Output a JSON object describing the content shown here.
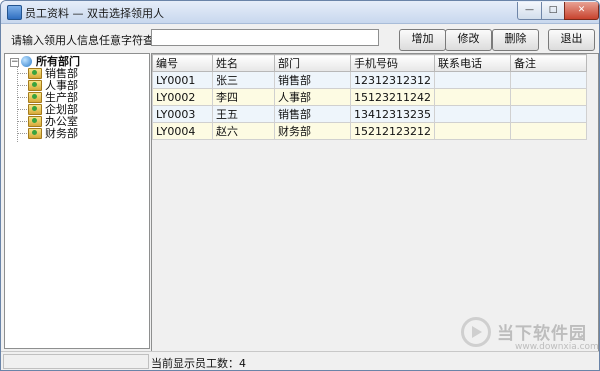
{
  "window": {
    "title": "员工资料 — 双击选择领用人",
    "minimize_glyph": "—",
    "maximize_glyph": "□",
    "close_glyph": "✕"
  },
  "toolbar": {
    "search_label": "请输入领用人信息任意字符查找",
    "search_value": "",
    "add_label": "增加",
    "edit_label": "修改",
    "delete_label": "删除",
    "exit_label": "退出"
  },
  "tree": {
    "toggle_glyph": "−",
    "root_label": "所有部门",
    "items": [
      {
        "label": "销售部"
      },
      {
        "label": "人事部"
      },
      {
        "label": "生产部"
      },
      {
        "label": "企划部"
      },
      {
        "label": "办公室"
      },
      {
        "label": "财务部"
      }
    ]
  },
  "grid": {
    "columns": [
      "编号",
      "姓名",
      "部门",
      "手机号码",
      "联系电话",
      "备注"
    ],
    "rows": [
      [
        "LY0001",
        "张三",
        "销售部",
        "12312312312",
        "",
        ""
      ],
      [
        "LY0002",
        "李四",
        "人事部",
        "15123211242",
        "",
        ""
      ],
      [
        "LY0003",
        "王五",
        "销售部",
        "13412313235",
        "",
        ""
      ],
      [
        "LY0004",
        "赵六",
        "财务部",
        "15212123212",
        "",
        ""
      ]
    ]
  },
  "status": {
    "text": "当前显示员工数：4"
  },
  "watermark": {
    "title": "当下软件园",
    "url": "www.downxia.com"
  },
  "colors": {
    "row_odd": "#eef5fb",
    "row_even": "#fdfbe3",
    "title_bar": "#c8d8ee",
    "close_button": "#c8432e"
  }
}
